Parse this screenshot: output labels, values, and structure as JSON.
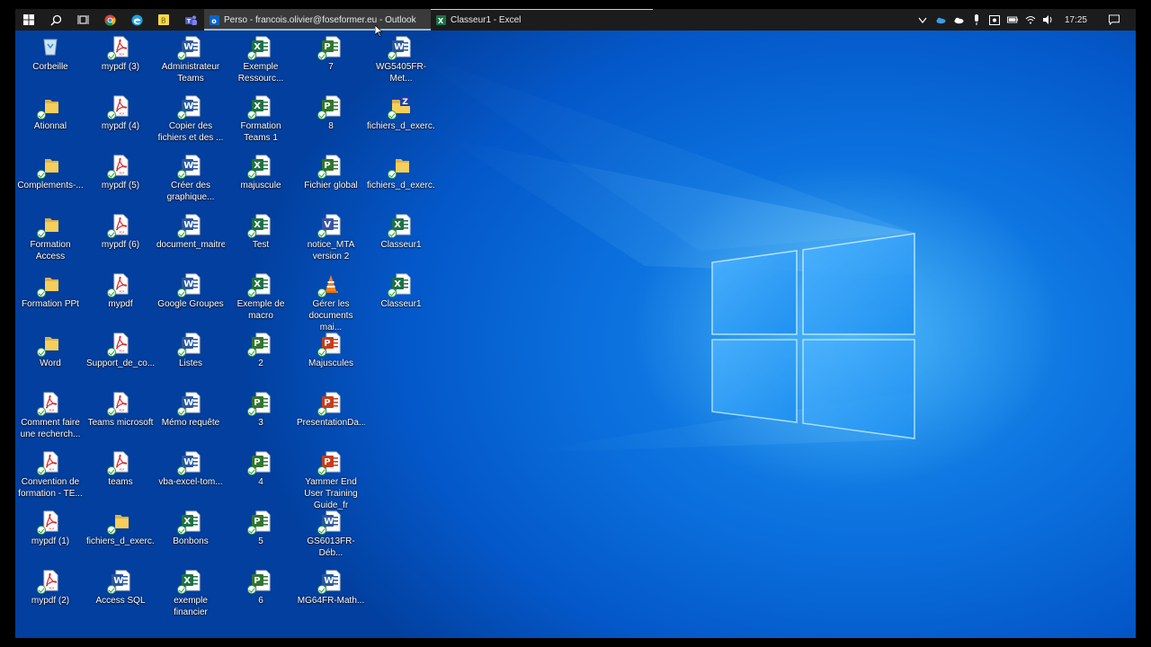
{
  "taskbar": {
    "outlook_title": "Perso - francois.olivier@foseformer.eu - Outlook",
    "excel_title": "Classeur1 - Excel",
    "clock": "17:25"
  },
  "desktop_icons": [
    {
      "label": "Corbeille",
      "type": "recycle"
    },
    {
      "label": "Ationnal",
      "type": "folder"
    },
    {
      "label": "Complements-...",
      "type": "folder"
    },
    {
      "label": "Formation Access",
      "type": "folder"
    },
    {
      "label": "Formation PPt",
      "type": "folder"
    },
    {
      "label": "Word",
      "type": "folder"
    },
    {
      "label": "Comment faire une recherch...",
      "type": "pdf"
    },
    {
      "label": "Convention de formation - TE...",
      "type": "pdf"
    },
    {
      "label": "mypdf (1)",
      "type": "pdf"
    },
    {
      "label": "mypdf (2)",
      "type": "pdf"
    },
    {
      "label": "mypdf (3)",
      "type": "pdf"
    },
    {
      "label": "mypdf (4)",
      "type": "pdf"
    },
    {
      "label": "mypdf (5)",
      "type": "pdf"
    },
    {
      "label": "mypdf (6)",
      "type": "pdf"
    },
    {
      "label": "mypdf",
      "type": "pdf"
    },
    {
      "label": "Support_de_co...",
      "type": "pdf"
    },
    {
      "label": "Teams microsoft",
      "type": "pdf"
    },
    {
      "label": "teams",
      "type": "pdf"
    },
    {
      "label": "fichiers_d_exerc...",
      "type": "folder"
    },
    {
      "label": "Access SQL",
      "type": "word"
    },
    {
      "label": "Administrateur Teams",
      "type": "word"
    },
    {
      "label": "Copier des fichiers et des ...",
      "type": "word"
    },
    {
      "label": "Créer des graphique...",
      "type": "word"
    },
    {
      "label": "document_maitre",
      "type": "word"
    },
    {
      "label": "Google Groupes",
      "type": "word"
    },
    {
      "label": "Listes",
      "type": "word"
    },
    {
      "label": "Mémo requête",
      "type": "word"
    },
    {
      "label": "vba-excel-tom...",
      "type": "word"
    },
    {
      "label": "Bonbons",
      "type": "excel"
    },
    {
      "label": "exemple financier",
      "type": "excel"
    },
    {
      "label": "Exemple Ressourc...",
      "type": "excel"
    },
    {
      "label": "Formation Teams 1",
      "type": "excel"
    },
    {
      "label": "majuscule",
      "type": "excel"
    },
    {
      "label": "Test",
      "type": "excel"
    },
    {
      "label": "Exemple de macro",
      "type": "excel"
    },
    {
      "label": "2",
      "type": "project"
    },
    {
      "label": "3",
      "type": "project"
    },
    {
      "label": "4",
      "type": "project"
    },
    {
      "label": "5",
      "type": "project"
    },
    {
      "label": "6",
      "type": "project"
    },
    {
      "label": "7",
      "type": "project"
    },
    {
      "label": "8",
      "type": "project"
    },
    {
      "label": "Fichier global",
      "type": "project"
    },
    {
      "label": "notice_MTA version 2",
      "type": "visio"
    },
    {
      "label": "Gérer les documents mai...",
      "type": "vlc"
    },
    {
      "label": "Majuscules",
      "type": "ppt"
    },
    {
      "label": "PresentationDa...",
      "type": "ppt"
    },
    {
      "label": "Yammer End User Training Guide_fr",
      "type": "ppt"
    },
    {
      "label": "GS6013FR-Déb...",
      "type": "word"
    },
    {
      "label": "MG64FR-Math...",
      "type": "word"
    },
    {
      "label": "WG5405FR-Met...",
      "type": "word"
    },
    {
      "label": "fichiers_d_exerc...",
      "type": "zip"
    },
    {
      "label": "fichiers_d_exerc...",
      "type": "folder"
    },
    {
      "label": "Classeur1",
      "type": "excel"
    },
    {
      "label": "Classeur1",
      "type": "excel"
    }
  ]
}
